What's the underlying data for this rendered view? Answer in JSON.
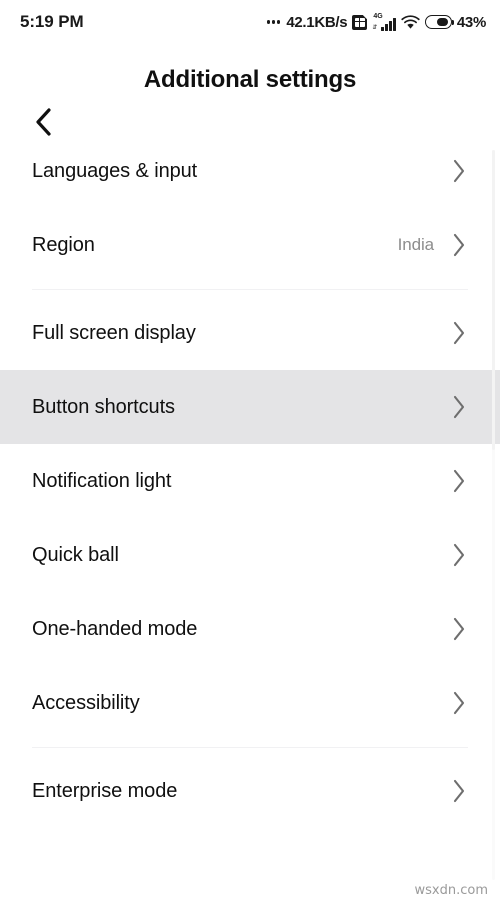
{
  "statusbar": {
    "clock": "5:19 PM",
    "network_speed": "42.1KB/s",
    "sim_icon": "sim-card-icon",
    "network_type": "4G",
    "signal_icon": "cellular-signal-icon",
    "wifi_icon": "wifi-icon",
    "battery_icon": "battery-icon",
    "battery_percent": "43%"
  },
  "appbar": {
    "back_icon": "chevron-left-icon",
    "title": "Additional settings"
  },
  "list": {
    "chevron_icon": "chevron-right-icon",
    "groups": [
      {
        "items": [
          {
            "label": "Languages & input",
            "value": "",
            "selected": false
          },
          {
            "label": "Region",
            "value": "India",
            "selected": false
          }
        ]
      },
      {
        "items": [
          {
            "label": "Full screen display",
            "value": "",
            "selected": false
          },
          {
            "label": "Button shortcuts",
            "value": "",
            "selected": true
          },
          {
            "label": "Notification light",
            "value": "",
            "selected": false
          },
          {
            "label": "Quick ball",
            "value": "",
            "selected": false
          },
          {
            "label": "One-handed mode",
            "value": "",
            "selected": false
          },
          {
            "label": "Accessibility",
            "value": "",
            "selected": false
          }
        ]
      },
      {
        "items": [
          {
            "label": "Enterprise mode",
            "value": "",
            "selected": false
          }
        ]
      }
    ]
  },
  "watermark": "wsxdn.com",
  "colors": {
    "background": "#ffffff",
    "text_primary": "#101010",
    "text_secondary": "#8d8d8d",
    "row_selected": "#e4e4e6",
    "divider": "#f1f1f3",
    "chevron": "#6e6e6e"
  }
}
